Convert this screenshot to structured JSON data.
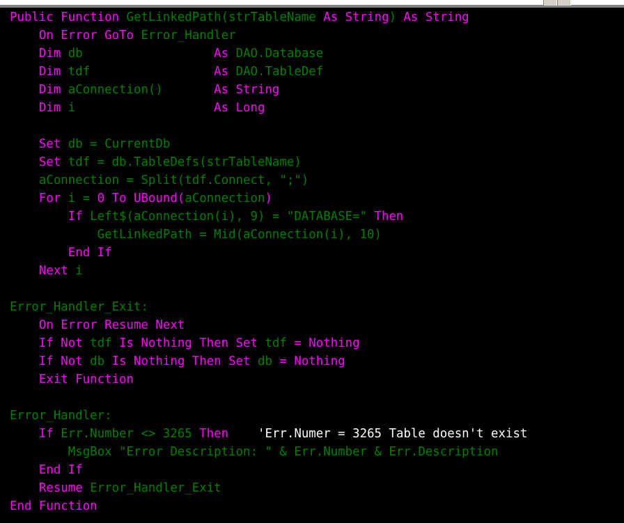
{
  "window": {
    "chrome": {
      "type": "title-bar-strip",
      "background_color": "#d4d0c8",
      "highlight_color": "#ffffff",
      "shadow_color": "#808080"
    }
  },
  "editor": {
    "name": "vba-code-editor",
    "background_color": "#000000",
    "font_size_px": 17.4,
    "line_height_px": 26,
    "colors": {
      "keyword": "#ff00ff",
      "identifier": "#008000",
      "comment": "#ffffff",
      "background": "#000000"
    },
    "lines": [
      {
        "n": 1,
        "tokens": [
          {
            "t": "Public Function ",
            "c": "kw"
          },
          {
            "t": "GetLinkedPath(strTableName ",
            "c": "id"
          },
          {
            "t": "As String",
            "c": "kw"
          },
          {
            "t": ")",
            "c": "id"
          },
          {
            "t": " As String",
            "c": "kw"
          }
        ]
      },
      {
        "n": 2,
        "tokens": [
          {
            "t": "    On Error GoTo ",
            "c": "kw"
          },
          {
            "t": "Error_Handler",
            "c": "id"
          }
        ]
      },
      {
        "n": 3,
        "tokens": [
          {
            "t": "    Dim ",
            "c": "kw"
          },
          {
            "t": "db                  ",
            "c": "id"
          },
          {
            "t": "As ",
            "c": "kw"
          },
          {
            "t": "DAO.Database",
            "c": "id"
          }
        ]
      },
      {
        "n": 4,
        "tokens": [
          {
            "t": "    Dim ",
            "c": "kw"
          },
          {
            "t": "tdf                 ",
            "c": "id"
          },
          {
            "t": "As ",
            "c": "kw"
          },
          {
            "t": "DAO.TableDef",
            "c": "id"
          }
        ]
      },
      {
        "n": 5,
        "tokens": [
          {
            "t": "    Dim ",
            "c": "kw"
          },
          {
            "t": "aConnection()       ",
            "c": "id"
          },
          {
            "t": "As String",
            "c": "kw"
          }
        ]
      },
      {
        "n": 6,
        "tokens": [
          {
            "t": "    Dim ",
            "c": "kw"
          },
          {
            "t": "i                   ",
            "c": "id"
          },
          {
            "t": "As Long",
            "c": "kw"
          }
        ]
      },
      {
        "n": 7,
        "tokens": []
      },
      {
        "n": 8,
        "tokens": [
          {
            "t": "    Set ",
            "c": "kw"
          },
          {
            "t": "db = CurrentDb",
            "c": "id"
          }
        ]
      },
      {
        "n": 9,
        "tokens": [
          {
            "t": "    Set ",
            "c": "kw"
          },
          {
            "t": "tdf = db.TableDefs(strTableName)",
            "c": "id"
          }
        ]
      },
      {
        "n": 10,
        "tokens": [
          {
            "t": "    aConnection = Split(tdf.Connect, \";\")",
            "c": "id"
          }
        ]
      },
      {
        "n": 11,
        "tokens": [
          {
            "t": "    For ",
            "c": "kw"
          },
          {
            "t": "i ",
            "c": "id"
          },
          {
            "t": "= ",
            "c": "id"
          },
          {
            "t": "0 To UBound(",
            "c": "kw"
          },
          {
            "t": "aConnection",
            "c": "id"
          },
          {
            "t": ")",
            "c": "kw"
          }
        ]
      },
      {
        "n": 12,
        "tokens": [
          {
            "t": "        If ",
            "c": "kw"
          },
          {
            "t": "Left$(aConnection(i), 9) = \"DATABASE=\" ",
            "c": "id"
          },
          {
            "t": "Then",
            "c": "kw"
          }
        ]
      },
      {
        "n": 13,
        "tokens": [
          {
            "t": "            GetLinkedPath = Mid(aConnection(i), 10)",
            "c": "id"
          }
        ]
      },
      {
        "n": 14,
        "tokens": [
          {
            "t": "        End If",
            "c": "kw"
          }
        ]
      },
      {
        "n": 15,
        "tokens": [
          {
            "t": "    Next ",
            "c": "kw"
          },
          {
            "t": "i",
            "c": "id"
          }
        ]
      },
      {
        "n": 16,
        "tokens": []
      },
      {
        "n": 17,
        "tokens": [
          {
            "t": "Error_Handler_Exit:",
            "c": "id"
          }
        ]
      },
      {
        "n": 18,
        "tokens": [
          {
            "t": "    On Error Resume Next",
            "c": "kw"
          }
        ]
      },
      {
        "n": 19,
        "tokens": [
          {
            "t": "    If Not ",
            "c": "kw"
          },
          {
            "t": "tdf ",
            "c": "id"
          },
          {
            "t": "Is Nothing Then Set ",
            "c": "kw"
          },
          {
            "t": "tdf ",
            "c": "id"
          },
          {
            "t": "= Nothing",
            "c": "kw"
          }
        ]
      },
      {
        "n": 20,
        "tokens": [
          {
            "t": "    If Not ",
            "c": "kw"
          },
          {
            "t": "db ",
            "c": "id"
          },
          {
            "t": "Is Nothing Then Set ",
            "c": "kw"
          },
          {
            "t": "db ",
            "c": "id"
          },
          {
            "t": "= Nothing",
            "c": "kw"
          }
        ]
      },
      {
        "n": 21,
        "tokens": [
          {
            "t": "    Exit Function",
            "c": "kw"
          }
        ]
      },
      {
        "n": 22,
        "tokens": []
      },
      {
        "n": 23,
        "tokens": [
          {
            "t": "Error_Handler:",
            "c": "id"
          }
        ]
      },
      {
        "n": 24,
        "tokens": [
          {
            "t": "    If ",
            "c": "kw"
          },
          {
            "t": "Err.Number <> 3265 ",
            "c": "id"
          },
          {
            "t": "Then",
            "c": "kw"
          },
          {
            "t": "    ",
            "c": "id"
          },
          {
            "t": "'Err.Numer = 3265 Table doesn't exist",
            "c": "cmt"
          }
        ]
      },
      {
        "n": 25,
        "tokens": [
          {
            "t": "        MsgBox \"Error Description: \" & Err.Number & Err.Description",
            "c": "id"
          }
        ]
      },
      {
        "n": 26,
        "tokens": [
          {
            "t": "    End If",
            "c": "kw"
          }
        ]
      },
      {
        "n": 27,
        "tokens": [
          {
            "t": "    Resume ",
            "c": "kw"
          },
          {
            "t": "Error_Handler_Exit",
            "c": "id"
          }
        ]
      },
      {
        "n": 28,
        "tokens": [
          {
            "t": "End Function",
            "c": "kw"
          }
        ]
      }
    ],
    "plain_text": "Public Function GetLinkedPath(strTableName As String) As String\n    On Error GoTo Error_Handler\n    Dim db                  As DAO.Database\n    Dim tdf                 As DAO.TableDef\n    Dim aConnection()       As String\n    Dim i                   As Long\n\n    Set db = CurrentDb\n    Set tdf = db.TableDefs(strTableName)\n    aConnection = Split(tdf.Connect, \";\")\n    For i = 0 To UBound(aConnection)\n        If Left$(aConnection(i), 9) = \"DATABASE=\" Then\n            GetLinkedPath = Mid(aConnection(i), 10)\n        End If\n    Next i\n\nError_Handler_Exit:\n    On Error Resume Next\n    If Not tdf Is Nothing Then Set tdf = Nothing\n    If Not db Is Nothing Then Set db = Nothing\n    Exit Function\n\nError_Handler:\n    If Err.Number <> 3265 Then    'Err.Numer = 3265 Table doesn't exist\n        MsgBox \"Error Description: \" & Err.Number & Err.Description\n    End If\n    Resume Error_Handler_Exit\nEnd Function"
  }
}
